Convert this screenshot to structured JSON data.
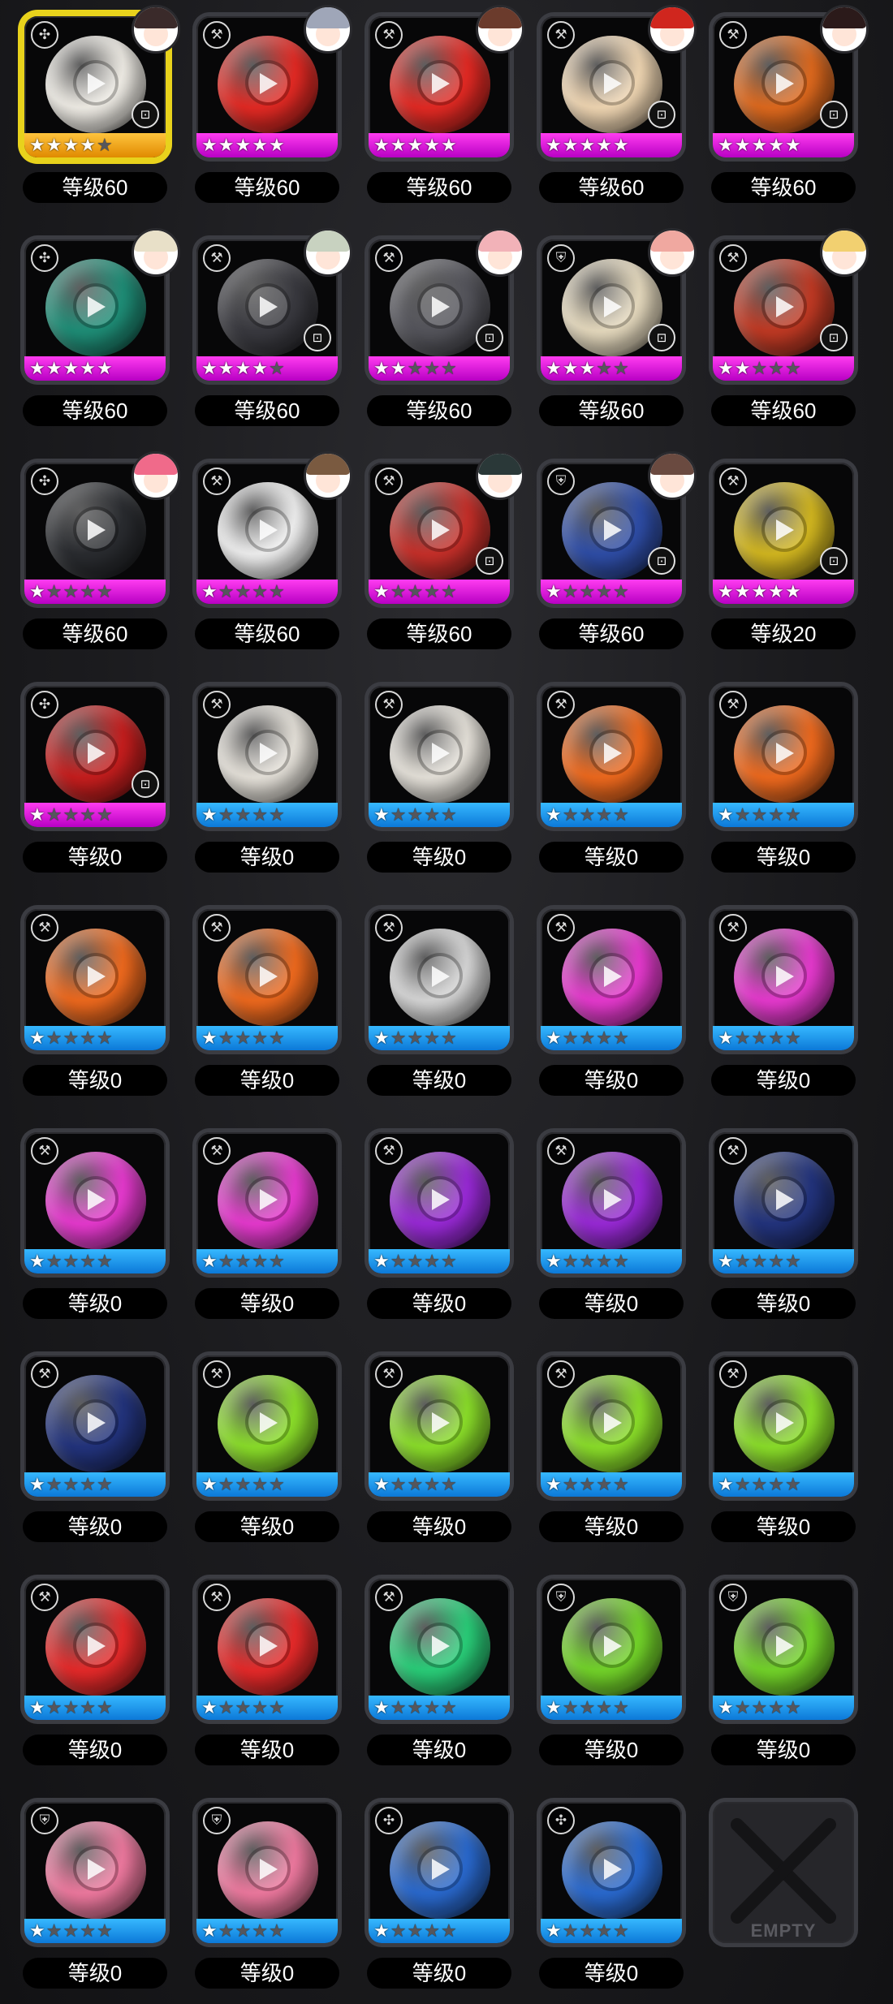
{
  "slot_row_heights": [
    275,
    275,
    275,
    275,
    275,
    275,
    275,
    275,
    275
  ],
  "items": [
    {
      "level": "等级60",
      "stars": 4,
      "rarity": "gold",
      "color": "#f2efe8",
      "icon": "cross",
      "locked": true,
      "avatar": "#3a2a2a",
      "selected": true
    },
    {
      "level": "等级60",
      "stars": 5,
      "rarity": "magenta",
      "color": "#e52a24",
      "icon": "pickaxe",
      "locked": false,
      "avatar": "#9fa6b8"
    },
    {
      "level": "等级60",
      "stars": 5,
      "rarity": "magenta",
      "color": "#e52a24",
      "icon": "pickaxe",
      "locked": false,
      "avatar": "#6b3b2c"
    },
    {
      "level": "等级60",
      "stars": 5,
      "rarity": "magenta",
      "color": "#f2d8b4",
      "icon": "pickaxe",
      "locked": true,
      "avatar": "#d0261e"
    },
    {
      "level": "等级60",
      "stars": 5,
      "rarity": "magenta",
      "color": "#e06a1e",
      "icon": "pickaxe",
      "locked": true,
      "avatar": "#2b1a1a"
    },
    {
      "level": "等级60",
      "stars": 5,
      "rarity": "magenta",
      "color": "#1f8f78",
      "icon": "cross",
      "locked": false,
      "avatar": "#e8e0c8"
    },
    {
      "level": "等级60",
      "stars": 4,
      "rarity": "magenta",
      "color": "#3a3a40",
      "icon": "pickaxe",
      "locked": true,
      "avatar": "#c8d2c0"
    },
    {
      "level": "等级60",
      "stars": 2,
      "rarity": "magenta",
      "color": "#55555c",
      "icon": "pickaxe",
      "locked": true,
      "avatar": "#f2b2b8"
    },
    {
      "level": "等级60",
      "stars": 3,
      "rarity": "magenta",
      "color": "#e8dcc0",
      "icon": "shield",
      "locked": true,
      "avatar": "#f0a8a0"
    },
    {
      "level": "等级60",
      "stars": 2,
      "rarity": "magenta",
      "color": "#c23a24",
      "icon": "pickaxe",
      "locked": true,
      "avatar": "#f2d070"
    },
    {
      "level": "等级60",
      "stars": 1,
      "rarity": "magenta",
      "color": "#2a2c30",
      "icon": "cross",
      "locked": false,
      "avatar": "#f06a8a"
    },
    {
      "level": "等级60",
      "stars": 1,
      "rarity": "magenta",
      "color": "#f2f2f2",
      "icon": "pickaxe",
      "locked": false,
      "avatar": "#7a5a40"
    },
    {
      "level": "等级60",
      "stars": 1,
      "rarity": "magenta",
      "color": "#c8302a",
      "icon": "pickaxe",
      "locked": true,
      "avatar": "#2a3838"
    },
    {
      "level": "等级60",
      "stars": 1,
      "rarity": "magenta",
      "color": "#2f4ea8",
      "icon": "shield",
      "locked": true,
      "avatar": "#6a4a40"
    },
    {
      "level": "等级20",
      "stars": 5,
      "rarity": "magenta",
      "color": "#d4b820",
      "icon": "pickaxe",
      "locked": true,
      "avatar": ""
    },
    {
      "level": "等级0",
      "stars": 1,
      "rarity": "magenta",
      "color": "#c81e1e",
      "icon": "cross",
      "locked": true,
      "avatar": ""
    },
    {
      "level": "等级0",
      "stars": 1,
      "rarity": "blue",
      "color": "#e8e4dc",
      "icon": "pickaxe",
      "locked": false,
      "avatar": ""
    },
    {
      "level": "等级0",
      "stars": 1,
      "rarity": "blue",
      "color": "#e8e4dc",
      "icon": "pickaxe",
      "locked": false,
      "avatar": ""
    },
    {
      "level": "等级0",
      "stars": 1,
      "rarity": "blue",
      "color": "#f06a1e",
      "icon": "pickaxe",
      "locked": false,
      "avatar": ""
    },
    {
      "level": "等级0",
      "stars": 1,
      "rarity": "blue",
      "color": "#f06a1e",
      "icon": "pickaxe",
      "locked": false,
      "avatar": ""
    },
    {
      "level": "等级0",
      "stars": 1,
      "rarity": "blue",
      "color": "#f06a1e",
      "icon": "pickaxe",
      "locked": false,
      "avatar": ""
    },
    {
      "level": "等级0",
      "stars": 1,
      "rarity": "blue",
      "color": "#f06a1e",
      "icon": "pickaxe",
      "locked": false,
      "avatar": ""
    },
    {
      "level": "等级0",
      "stars": 1,
      "rarity": "blue",
      "color": "#d8d8d8",
      "icon": "pickaxe",
      "locked": false,
      "avatar": ""
    },
    {
      "level": "等级0",
      "stars": 1,
      "rarity": "blue",
      "color": "#e83ad0",
      "icon": "pickaxe",
      "locked": false,
      "avatar": ""
    },
    {
      "level": "等级0",
      "stars": 1,
      "rarity": "blue",
      "color": "#e83ad0",
      "icon": "pickaxe",
      "locked": false,
      "avatar": ""
    },
    {
      "level": "等级0",
      "stars": 1,
      "rarity": "blue",
      "color": "#e83ad0",
      "icon": "pickaxe",
      "locked": false,
      "avatar": ""
    },
    {
      "level": "等级0",
      "stars": 1,
      "rarity": "blue",
      "color": "#e83ad0",
      "icon": "pickaxe",
      "locked": false,
      "avatar": ""
    },
    {
      "level": "等级0",
      "stars": 1,
      "rarity": "blue",
      "color": "#9a2ad8",
      "icon": "pickaxe",
      "locked": false,
      "avatar": ""
    },
    {
      "level": "等级0",
      "stars": 1,
      "rarity": "blue",
      "color": "#9a2ad8",
      "icon": "pickaxe",
      "locked": false,
      "avatar": ""
    },
    {
      "level": "等级0",
      "stars": 1,
      "rarity": "blue",
      "color": "#23347e",
      "icon": "pickaxe",
      "locked": false,
      "avatar": ""
    },
    {
      "level": "等级0",
      "stars": 1,
      "rarity": "blue",
      "color": "#23347e",
      "icon": "pickaxe",
      "locked": false,
      "avatar": ""
    },
    {
      "level": "等级0",
      "stars": 1,
      "rarity": "blue",
      "color": "#8ce02a",
      "icon": "pickaxe",
      "locked": false,
      "avatar": ""
    },
    {
      "level": "等级0",
      "stars": 1,
      "rarity": "blue",
      "color": "#8ce02a",
      "icon": "pickaxe",
      "locked": false,
      "avatar": ""
    },
    {
      "level": "等级0",
      "stars": 1,
      "rarity": "blue",
      "color": "#8ce02a",
      "icon": "pickaxe",
      "locked": false,
      "avatar": ""
    },
    {
      "level": "等级0",
      "stars": 1,
      "rarity": "blue",
      "color": "#8ce02a",
      "icon": "pickaxe",
      "locked": false,
      "avatar": ""
    },
    {
      "level": "等级0",
      "stars": 1,
      "rarity": "blue",
      "color": "#e82a2a",
      "icon": "pickaxe",
      "locked": false,
      "avatar": ""
    },
    {
      "level": "等级0",
      "stars": 1,
      "rarity": "blue",
      "color": "#e82a2a",
      "icon": "pickaxe",
      "locked": false,
      "avatar": ""
    },
    {
      "level": "等级0",
      "stars": 1,
      "rarity": "blue",
      "color": "#2ad07a",
      "icon": "pickaxe",
      "locked": false,
      "avatar": ""
    },
    {
      "level": "等级0",
      "stars": 1,
      "rarity": "blue",
      "color": "#74d62a",
      "icon": "shield",
      "locked": false,
      "avatar": ""
    },
    {
      "level": "等级0",
      "stars": 1,
      "rarity": "blue",
      "color": "#74d62a",
      "icon": "shield",
      "locked": false,
      "avatar": ""
    },
    {
      "level": "等级0",
      "stars": 1,
      "rarity": "blue",
      "color": "#f07aa0",
      "icon": "shield",
      "locked": false,
      "avatar": ""
    },
    {
      "level": "等级0",
      "stars": 1,
      "rarity": "blue",
      "color": "#f07aa0",
      "icon": "shield",
      "locked": false,
      "avatar": ""
    },
    {
      "level": "等级0",
      "stars": 1,
      "rarity": "blue",
      "color": "#2a6ad0",
      "icon": "cross",
      "locked": false,
      "avatar": ""
    },
    {
      "level": "等级0",
      "stars": 1,
      "rarity": "blue",
      "color": "#2a6ad0",
      "icon": "cross",
      "locked": false,
      "avatar": ""
    }
  ],
  "empty_slot": {
    "label": "EMPTY"
  }
}
